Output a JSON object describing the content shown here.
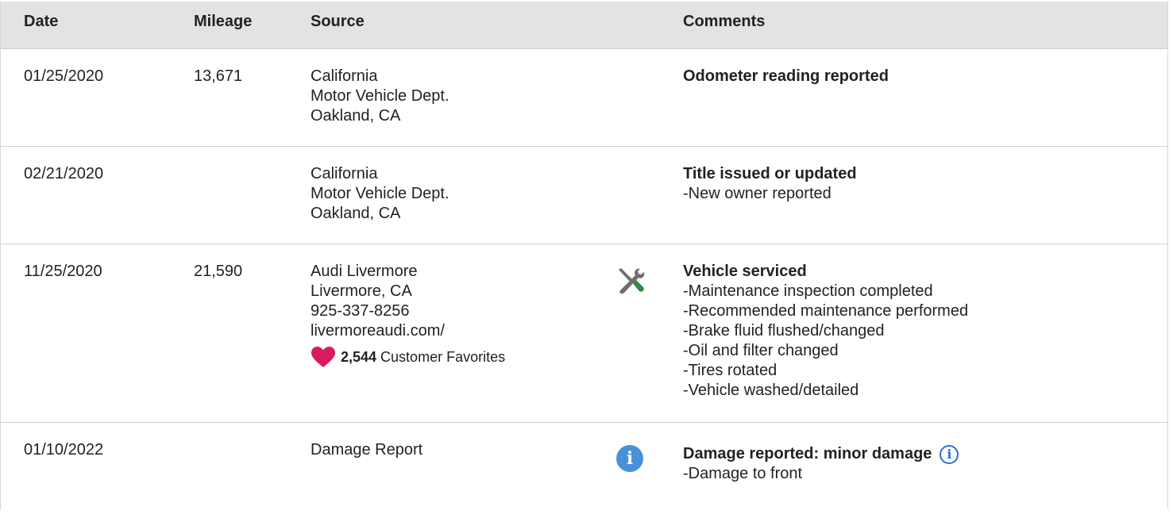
{
  "header": {
    "date": "Date",
    "mileage": "Mileage",
    "source": "Source",
    "comments": "Comments"
  },
  "rows": [
    {
      "date": "01/25/2020",
      "mileage": "13,671",
      "source": [
        "California",
        "Motor Vehicle Dept.",
        "Oakland, CA"
      ],
      "comment_title": "Odometer reading reported",
      "bullets": []
    },
    {
      "date": "02/21/2020",
      "mileage": "",
      "source": [
        "California",
        "Motor Vehicle Dept.",
        "Oakland, CA"
      ],
      "comment_title": "Title issued or updated",
      "bullets": [
        "New owner reported"
      ]
    },
    {
      "date": "11/25/2020",
      "mileage": "21,590",
      "source": [
        "Audi Livermore",
        "Livermore, CA",
        "925-337-8256",
        "livermoreaudi.com/"
      ],
      "favorites_count": "2,544",
      "favorites_label": "Customer Favorites",
      "icon": "service-tools-icon",
      "comment_title": "Vehicle serviced",
      "bullets": [
        "Maintenance inspection completed",
        "Recommended maintenance performed",
        "Brake fluid flushed/changed",
        "Oil and filter changed",
        "Tires rotated",
        "Vehicle washed/detailed"
      ]
    },
    {
      "date": "01/10/2022",
      "mileage": "",
      "source": [
        "Damage Report"
      ],
      "icon": "info-icon",
      "icon_glyph": "i",
      "comment_title": "Damage reported: minor damage",
      "info_glyph": "i",
      "bullets": [
        "Damage to front"
      ]
    }
  ],
  "colors": {
    "header_bg": "#e3e3e3",
    "heart": "#d81b60",
    "info_blue": "#4a90d9",
    "wrench_green": "#2e8b3e",
    "tool_gray": "#6e6e6e"
  }
}
